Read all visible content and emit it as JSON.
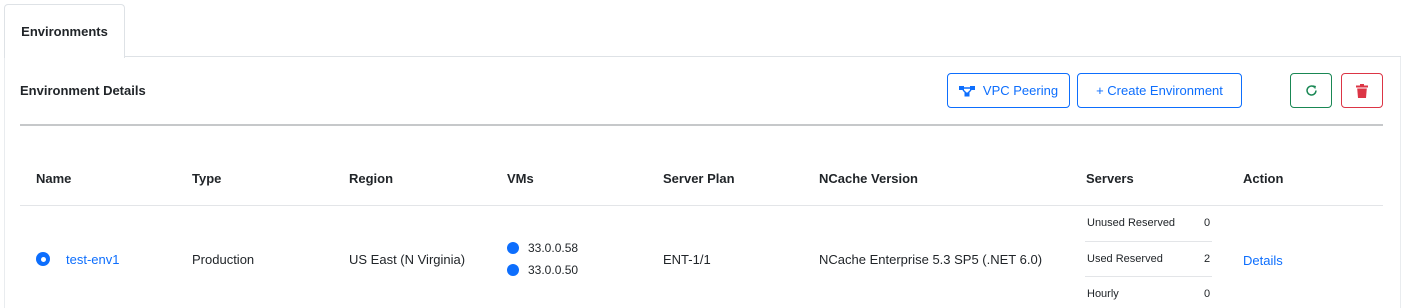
{
  "tabs": [
    {
      "label": "Environments",
      "active": true
    }
  ],
  "section": {
    "title": "Environment Details"
  },
  "toolbar": {
    "vpc_peering_label": "VPC Peering",
    "create_environment_label": "+ Create Environment",
    "refresh_icon": "refresh-icon",
    "delete_icon": "trash-icon"
  },
  "table": {
    "columns": [
      "Name",
      "Type",
      "Region",
      "VMs",
      "Server Plan",
      "NCache Version",
      "Servers",
      "Action"
    ],
    "rows": [
      {
        "selected": true,
        "name": "test-env1",
        "type": "Production",
        "region": "US East (N Virginia)",
        "vms": [
          "33.0.0.58",
          "33.0.0.50"
        ],
        "server_plan": "ENT-1/1",
        "ncache_version": "NCache Enterprise 5.3 SP5 (.NET 6.0)",
        "servers": [
          {
            "label": "Unused Reserved",
            "value": "0"
          },
          {
            "label": "Used Reserved",
            "value": "2"
          },
          {
            "label": "Hourly",
            "value": "0"
          }
        ],
        "action": "Details"
      }
    ]
  },
  "colors": {
    "primary": "#0d6efd",
    "success": "#198754",
    "danger": "#dc3545"
  }
}
